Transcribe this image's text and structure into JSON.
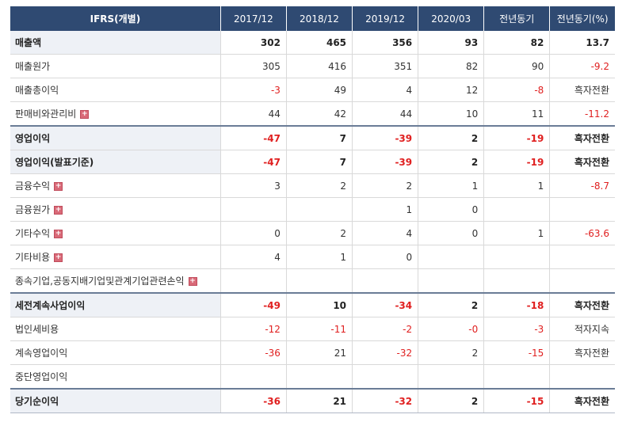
{
  "header": {
    "columns": [
      "IFRS(개별)",
      "2017/12",
      "2018/12",
      "2019/12",
      "2020/03",
      "전년동기",
      "전년동기(%)"
    ]
  },
  "rows": [
    {
      "label": "매출액",
      "bold": true,
      "expand": false,
      "values": [
        "302",
        "465",
        "356",
        "93",
        "82",
        "13.7"
      ]
    },
    {
      "label": "매출원가",
      "bold": false,
      "expand": false,
      "values": [
        "305",
        "416",
        "351",
        "82",
        "90",
        "-9.2"
      ]
    },
    {
      "label": "매출총이익",
      "bold": false,
      "expand": false,
      "values": [
        "-3",
        "49",
        "4",
        "12",
        "-8",
        "흑자전환"
      ]
    },
    {
      "label": "판매비와관리비",
      "bold": false,
      "expand": true,
      "values": [
        "44",
        "42",
        "44",
        "10",
        "11",
        "-11.2"
      ]
    },
    {
      "label": "영업이익",
      "bold": true,
      "expand": false,
      "values": [
        "-47",
        "7",
        "-39",
        "2",
        "-19",
        "흑자전환"
      ]
    },
    {
      "label": "영업이익(발표기준)",
      "bold": true,
      "expand": false,
      "values": [
        "-47",
        "7",
        "-39",
        "2",
        "-19",
        "흑자전환"
      ]
    },
    {
      "label": "금융수익",
      "bold": false,
      "expand": true,
      "values": [
        "3",
        "2",
        "2",
        "1",
        "1",
        "-8.7"
      ]
    },
    {
      "label": "금융원가",
      "bold": false,
      "expand": true,
      "values": [
        "",
        "",
        "1",
        "0",
        "",
        ""
      ]
    },
    {
      "label": "기타수익",
      "bold": false,
      "expand": true,
      "values": [
        "0",
        "2",
        "4",
        "0",
        "1",
        "-63.6"
      ]
    },
    {
      "label": "기타비용",
      "bold": false,
      "expand": true,
      "values": [
        "4",
        "1",
        "0",
        "",
        "",
        ""
      ]
    },
    {
      "label": "종속기업,공동지배기업및관계기업관련손익",
      "bold": false,
      "expand": true,
      "values": [
        "",
        "",
        "",
        "",
        "",
        ""
      ]
    },
    {
      "label": "세전계속사업이익",
      "bold": true,
      "expand": false,
      "values": [
        "-49",
        "10",
        "-34",
        "2",
        "-18",
        "흑자전환"
      ]
    },
    {
      "label": "법인세비용",
      "bold": false,
      "expand": false,
      "values": [
        "-12",
        "-11",
        "-2",
        "-0",
        "-3",
        "적자지속"
      ]
    },
    {
      "label": "계속영업이익",
      "bold": false,
      "expand": false,
      "values": [
        "-36",
        "21",
        "-32",
        "2",
        "-15",
        "흑자전환"
      ]
    },
    {
      "label": "중단영업이익",
      "bold": false,
      "expand": false,
      "values": [
        "",
        "",
        "",
        "",
        "",
        ""
      ]
    },
    {
      "label": "당기순이익",
      "bold": true,
      "expand": false,
      "values": [
        "-36",
        "21",
        "-32",
        "2",
        "-15",
        "흑자전환"
      ]
    }
  ],
  "colors": {
    "header_bg": "#2f4a72",
    "negative": "#e02020",
    "bold_label_bg": "#eef1f6"
  },
  "icons": {
    "expand": "plus-icon"
  },
  "expand_glyph": "+"
}
